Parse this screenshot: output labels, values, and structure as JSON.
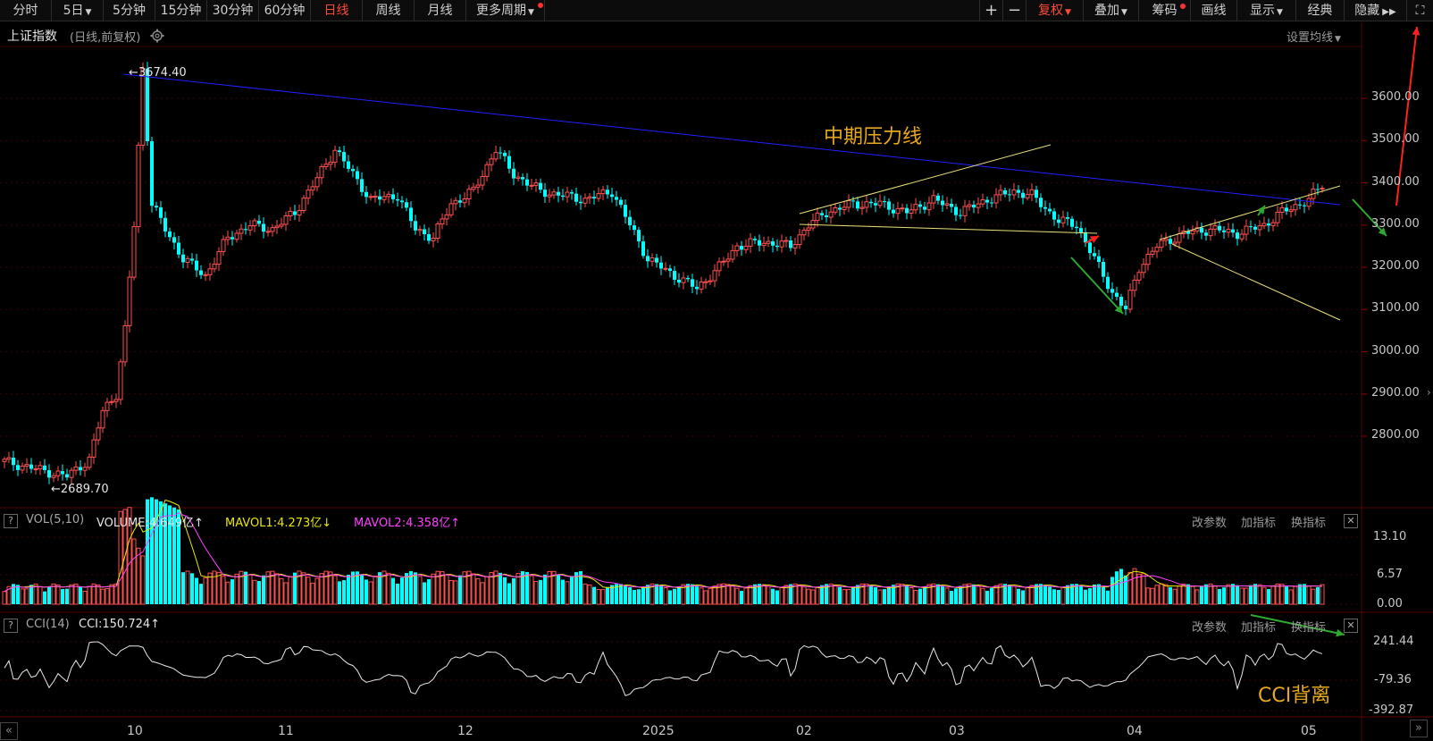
{
  "toolbar": {
    "tabs": [
      "分时",
      "5日",
      "5分钟",
      "15分钟",
      "30分钟",
      "60分钟",
      "日线",
      "周线",
      "月线",
      "更多周期"
    ],
    "active_tab": "日线",
    "right_buttons": [
      "+",
      "−",
      "复权",
      "叠加",
      "筹码",
      "画线",
      "显示",
      "经典",
      "隐藏"
    ],
    "colors": {
      "active": "#ff4a3a",
      "dot": "#ff3030"
    }
  },
  "chart_header": {
    "title": "上证指数",
    "subtitle": "(日线,前复权)",
    "set_ma": "设置均线"
  },
  "price_axis": [
    "3600.00",
    "3500.00",
    "3400.00",
    "3300.00",
    "3200.00",
    "3100.00",
    "3000.00",
    "2900.00",
    "2800.00"
  ],
  "markers": {
    "high": "3674.40",
    "low": "2689.70"
  },
  "annotations": {
    "mid_pressure": "中期压力线",
    "cci_divergence": "CCI背离"
  },
  "volume_panel": {
    "q": "?",
    "label": "VOL(5,10)",
    "volume": "VOLUME:4.649亿",
    "mavol1": "MAVOL1:4.273亿",
    "mavol2": "MAVOL2:4.358亿",
    "axis": [
      "13.10",
      "6.57",
      "0.00"
    ],
    "links": [
      "改参数",
      "加指标",
      "换指标"
    ]
  },
  "cci_panel": {
    "q": "?",
    "label": "CCI(14)",
    "cci": "CCI:150.724",
    "axis": [
      "241.44",
      "-79.36",
      "-392.87"
    ],
    "links": [
      "改参数",
      "加指标",
      "换指标"
    ]
  },
  "date_axis": [
    "10",
    "11",
    "12",
    "2025",
    "02",
    "03",
    "04",
    "05"
  ],
  "colors": {
    "up": "#ff5050",
    "down": "#00ffff",
    "ma1": "#e8e800",
    "ma2": "#ff40ff",
    "trend": "#2020ff",
    "channel": "#e8e07a"
  }
}
